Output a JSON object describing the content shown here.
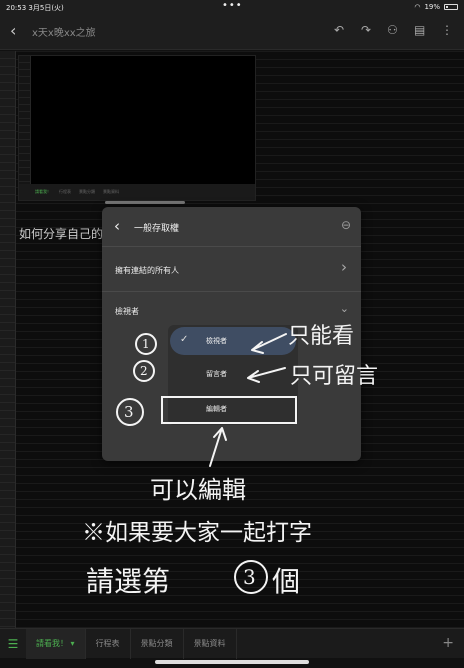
{
  "status_bar": {
    "time": "20:53",
    "date": "3月5日(火)",
    "dots": "•••",
    "battery": "19%"
  },
  "toolbar": {
    "back_icon": "‹",
    "title": "x天x晚xx之旅"
  },
  "page": {
    "question": "如何分享自己的"
  },
  "embedded_sheet": {
    "tabs": [
      "請看我！",
      "行程表",
      "景點分類",
      "景點資料"
    ]
  },
  "dialog": {
    "title": "一般存取權",
    "link_access": "擁有連結的所有人",
    "role_selected": "檢視者",
    "options": [
      {
        "label": "檢視者",
        "selected": true
      },
      {
        "label": "留言者",
        "selected": false
      },
      {
        "label": "編輯者",
        "selected": false
      }
    ]
  },
  "annotations": {
    "viewer_note": "只能看",
    "commenter_note": "只可留言",
    "editor_note": "可以編輯",
    "tip_line1": "※如果要大家一起打字",
    "tip_line2": "請選第",
    "tip_line2_end": "個",
    "circle_1": "1",
    "circle_2": "2",
    "circle_3": "3"
  },
  "bottom_tabs": [
    {
      "label": "請看我！",
      "active": true
    },
    {
      "label": "行程表",
      "active": false
    },
    {
      "label": "景點分類",
      "active": false
    },
    {
      "label": "景點資料",
      "active": false
    }
  ],
  "colors": {
    "accent": "#4caf50",
    "selected_option": "#3f4d63",
    "dialog_bg": "#3a3a3a"
  }
}
